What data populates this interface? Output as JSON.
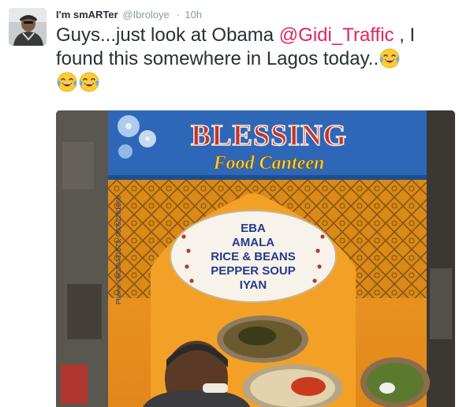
{
  "tweet": {
    "author_name": "I'm smARTer",
    "handle": "@Ibroloye",
    "separator": "·",
    "time": "10h",
    "text_part1": "Guys...just look at Obama ",
    "mention": "@Gidi_Traffic",
    "text_part2": " , I found this somewhere in Lagos today..",
    "emoji": "face-with-tears-of-joy-icon",
    "emoji_count": 3
  },
  "photo": {
    "sign_title": "BLESSING",
    "sign_subtitle": "Food Canteen",
    "menu_items": [
      "EBA",
      "AMALA",
      "RICE & BEANS",
      "PEPPER SOUP",
      "IYAN"
    ],
    "phone_text": "Phone: 08030431873, 08052261566"
  },
  "colors": {
    "name": "#292f33",
    "meta": "#8899a6",
    "mention": "#e0245e",
    "sign_blue": "#2f67b8",
    "sign_orange": "#e8961e",
    "title_red": "#c2342c",
    "subtitle_gold": "#f0d23a",
    "menu_text": "#253a8a"
  }
}
